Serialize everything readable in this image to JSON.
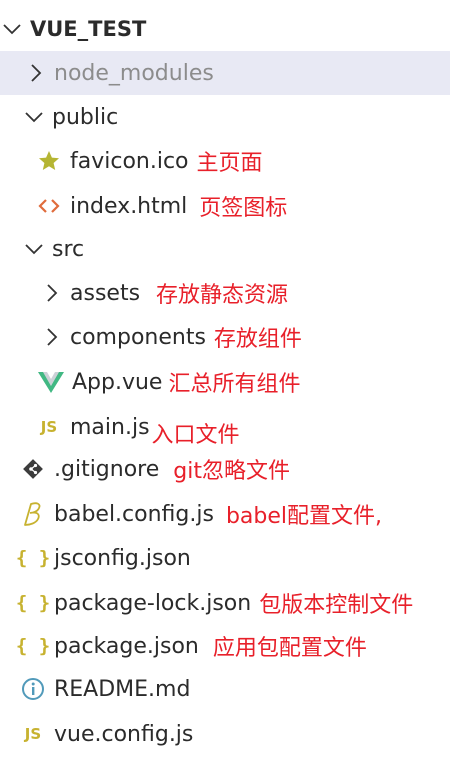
{
  "root": {
    "label": "VUE_TEST"
  },
  "items": {
    "node_modules": {
      "label": "node_modules"
    },
    "public": {
      "label": "public"
    },
    "favicon": {
      "label": "favicon.ico",
      "note": "主页面"
    },
    "index": {
      "label": "index.html",
      "note": "页签图标"
    },
    "src": {
      "label": "src"
    },
    "assets": {
      "label": "assets",
      "note": "存放静态资源"
    },
    "components": {
      "label": "components",
      "note": "存放组件"
    },
    "app": {
      "label": "App.vue",
      "note": "汇总所有组件"
    },
    "main": {
      "label": "main.js",
      "note": "入口文件"
    },
    "gitignore": {
      "label": ".gitignore",
      "note": "git忽略文件"
    },
    "babel": {
      "label": "babel.config.js",
      "note": "babel配置文件,"
    },
    "jsconfig": {
      "label": "jsconfig.json"
    },
    "packagelock": {
      "label": "package-lock.json",
      "note": "包版本控制文件"
    },
    "package": {
      "label": "package.json",
      "note": "应用包配置文件"
    },
    "readme": {
      "label": "README.md"
    },
    "vueconfig": {
      "label": "vue.config.js"
    }
  },
  "icons": {
    "js_text": "JS",
    "brace_text": "{ }"
  },
  "colors": {
    "note": "#e8202a",
    "selected_bg": "#e8e9f4",
    "vue_green": "#41b883",
    "json_yellow": "#c7b230"
  }
}
